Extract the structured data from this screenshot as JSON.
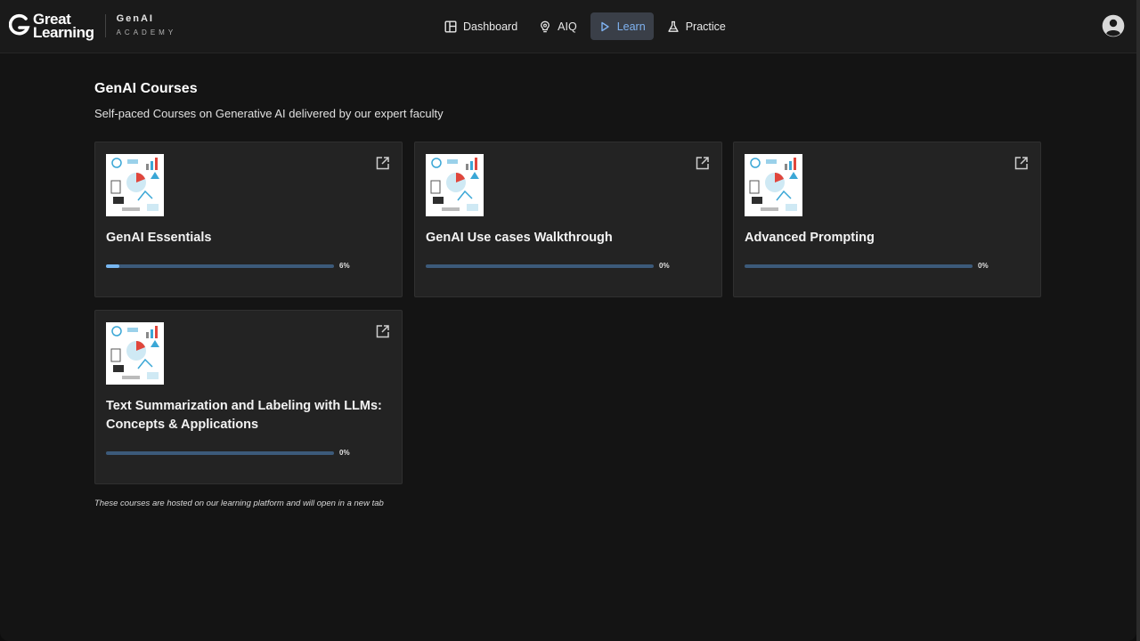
{
  "brand": {
    "line1": "Great",
    "line2": "Learning",
    "product": "GenAI",
    "product_sub": "ACADEMY"
  },
  "nav": {
    "items": [
      {
        "label": "Dashboard",
        "icon": "dashboard-icon"
      },
      {
        "label": "AIQ",
        "icon": "lightbulb-icon"
      },
      {
        "label": "Learn",
        "icon": "play-icon",
        "active": true
      },
      {
        "label": "Practice",
        "icon": "flask-icon"
      }
    ]
  },
  "user": {
    "icon": "user-avatar-icon"
  },
  "main": {
    "title": "GenAI Courses",
    "subtitle": "Self-paced Courses on Generative AI delivered by our expert faculty",
    "courses": [
      {
        "title": "GenAI Essentials",
        "progress": 6,
        "progress_label": "6%"
      },
      {
        "title": "GenAI Use cases Walkthrough",
        "progress": 0,
        "progress_label": "0%"
      },
      {
        "title": "Advanced Prompting",
        "progress": 0,
        "progress_label": "0%"
      },
      {
        "title": "Text Summarization and Labeling with LLMs: Concepts & Applications",
        "progress": 0,
        "progress_label": "0%"
      }
    ],
    "footnote": "These courses are hosted on our learning platform and will open in a new tab"
  },
  "colors": {
    "accent": "#7fb2f0",
    "progress_track": "#3c5a7a",
    "progress_fill": "#77b6f0",
    "card_bg": "#232323",
    "page_bg": "#141414"
  }
}
